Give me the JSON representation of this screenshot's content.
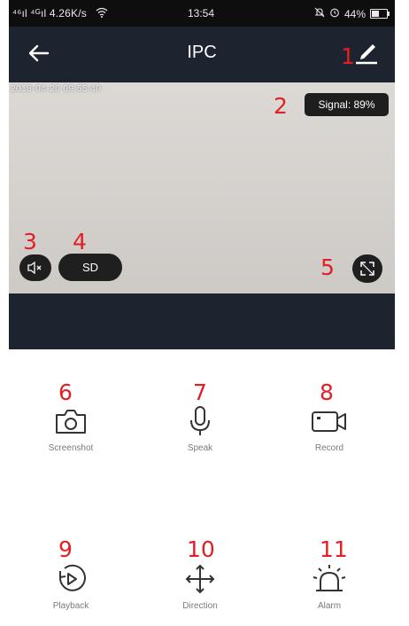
{
  "status_bar": {
    "left": "⁴⁶ıl ⁴ᴳıl 4.26K/s",
    "time": "13:54",
    "battery": "44%"
  },
  "header": {
    "title": "IPC"
  },
  "video": {
    "timestamp": "2018-04-20 09:55:40",
    "signal": "Signal: 89%",
    "sd_label": "SD"
  },
  "annotations": [
    "1",
    "2",
    "3",
    "4",
    "5",
    "6",
    "7",
    "8",
    "9",
    "10",
    "11"
  ],
  "controls": [
    {
      "label": "Screenshot",
      "icon": "camera-icon"
    },
    {
      "label": "Speak",
      "icon": "microphone-icon"
    },
    {
      "label": "Record",
      "icon": "video-camera-icon"
    },
    {
      "label": "Playback",
      "icon": "playback-icon"
    },
    {
      "label": "Direction",
      "icon": "direction-icon"
    },
    {
      "label": "Alarm",
      "icon": "alarm-icon"
    }
  ],
  "colors": {
    "accent_red": "#e31e24",
    "nav_bg": "#1d2430"
  }
}
